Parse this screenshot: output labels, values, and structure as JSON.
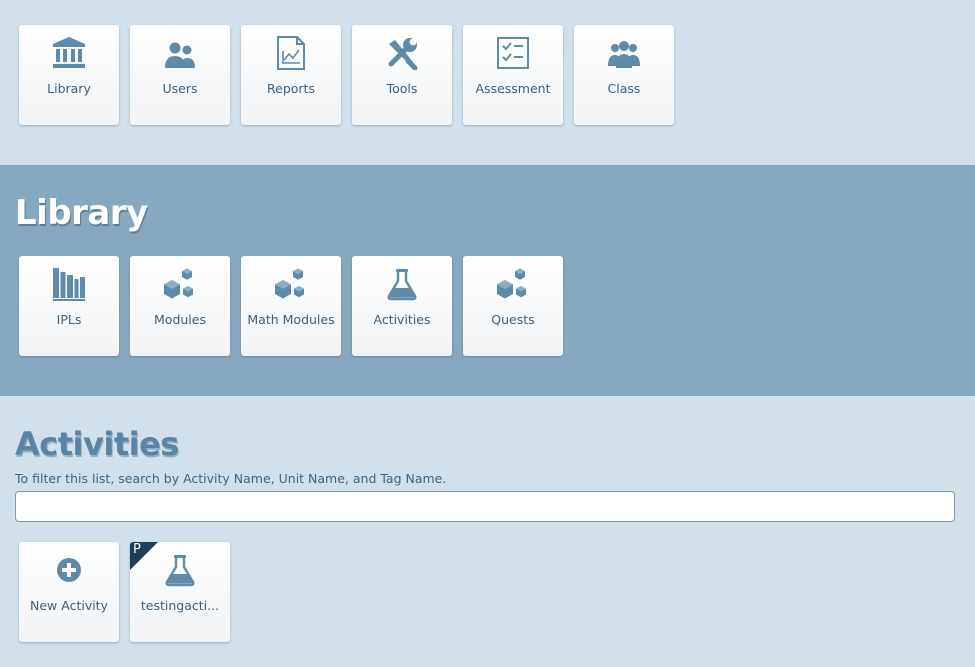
{
  "topnav": {
    "items": [
      {
        "label": "Library",
        "icon": "library-icon"
      },
      {
        "label": "Users",
        "icon": "users-icon"
      },
      {
        "label": "Reports",
        "icon": "reports-icon"
      },
      {
        "label": "Tools",
        "icon": "tools-icon"
      },
      {
        "label": "Assessment",
        "icon": "assessment-icon"
      },
      {
        "label": "Class",
        "icon": "class-icon"
      }
    ]
  },
  "library": {
    "title": "Library",
    "items": [
      {
        "label": "IPLs",
        "icon": "books-icon"
      },
      {
        "label": "Modules",
        "icon": "cubes-icon"
      },
      {
        "label": "Math Modules",
        "icon": "cubes-icon"
      },
      {
        "label": "Activities",
        "icon": "flask-icon"
      },
      {
        "label": "Quests",
        "icon": "cubes-icon"
      }
    ]
  },
  "activities": {
    "title": "Activities",
    "filter_hint": "To filter this list, search by Activity Name, Unit Name, and Tag Name.",
    "search_value": "",
    "new_activity_label": "New Activity",
    "items": [
      {
        "label": "testingacti...",
        "badge": "P",
        "icon": "flask-icon"
      }
    ]
  },
  "colors": {
    "page_bg": "#d1e0eb",
    "library_bg": "#86a9c0",
    "icon": "#5f8aa8",
    "badge": "#1e3d56"
  }
}
